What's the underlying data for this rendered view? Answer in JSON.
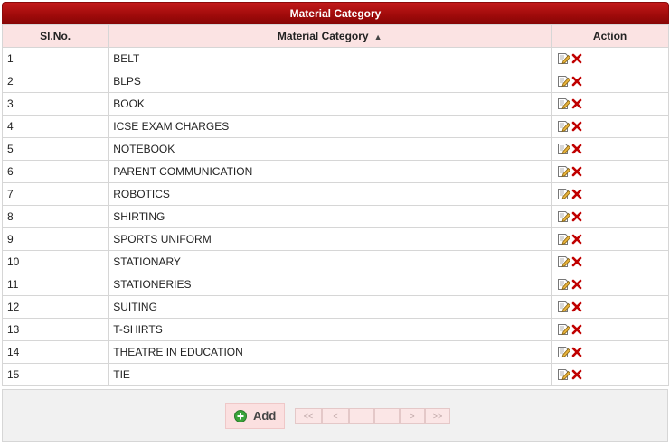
{
  "title": "Material Category",
  "columns": {
    "sl": "Sl.No.",
    "category": "Material Category",
    "action": "Action"
  },
  "rows": [
    {
      "sl": "1",
      "name": "BELT"
    },
    {
      "sl": "2",
      "name": "BLPS"
    },
    {
      "sl": "3",
      "name": "BOOK"
    },
    {
      "sl": "4",
      "name": "ICSE EXAM CHARGES"
    },
    {
      "sl": "5",
      "name": "NOTEBOOK"
    },
    {
      "sl": "6",
      "name": "PARENT COMMUNICATION"
    },
    {
      "sl": "7",
      "name": "ROBOTICS"
    },
    {
      "sl": "8",
      "name": "SHIRTING"
    },
    {
      "sl": "9",
      "name": "SPORTS UNIFORM"
    },
    {
      "sl": "10",
      "name": "STATIONARY"
    },
    {
      "sl": "11",
      "name": "STATIONERIES"
    },
    {
      "sl": "12",
      "name": "SUITING"
    },
    {
      "sl": "13",
      "name": "T-SHIRTS"
    },
    {
      "sl": "14",
      "name": "THEATRE IN EDUCATION"
    },
    {
      "sl": "15",
      "name": "TIE"
    }
  ],
  "footer": {
    "add_label": "Add",
    "pager": {
      "first": "<<",
      "prev": "<",
      "next": ">",
      "last": ">>"
    }
  },
  "colors": {
    "title_bar": "#a50f0f",
    "header_bg": "#fbe3e3",
    "delete": "#c00000",
    "add_icon": "#3aa33a"
  }
}
